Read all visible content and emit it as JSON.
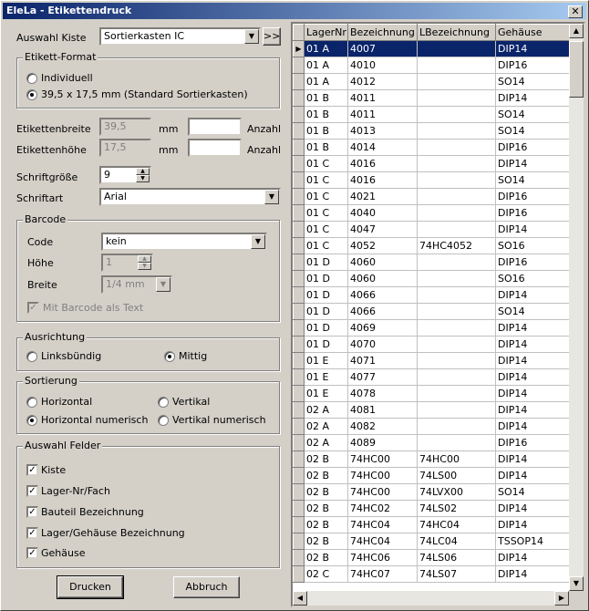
{
  "window": {
    "title": "EleLa - Etikettendruck",
    "close_glyph": "✕"
  },
  "kiste": {
    "label": "Auswahl Kiste",
    "value": "Sortierkasten IC",
    "more_label": ">>"
  },
  "format": {
    "title": "Etikett-Format",
    "options": [
      {
        "label": "Individuell",
        "selected": false
      },
      {
        "label": "39,5 x 17,5 mm (Standard Sortierkasten)",
        "selected": true
      }
    ]
  },
  "size": {
    "width_label": "Etikettenbreite",
    "width_value": "39,5",
    "width_unit": "mm",
    "width_count": "",
    "count_label": "Anzahl",
    "height_label": "Etikettenhöhe",
    "height_value": "17,5",
    "height_unit": "mm",
    "height_count": ""
  },
  "font": {
    "size_label": "Schriftgröße",
    "size_value": "9",
    "type_label": "Schriftart",
    "type_value": "Arial"
  },
  "barcode": {
    "title": "Barcode",
    "code_label": "Code",
    "code_value": "kein",
    "hoehe_label": "Höhe",
    "hoehe_value": "1",
    "breite_label": "Breite",
    "breite_value": "1/4 mm",
    "as_text_label": "Mit Barcode als Text"
  },
  "ausrichtung": {
    "title": "Ausrichtung",
    "left_label": "Linksbündig",
    "center_label": "Mittig"
  },
  "sortierung": {
    "title": "Sortierung",
    "horizontal": "Horizontal",
    "vertikal": "Vertikal",
    "horizontal_num": "Horizontal numerisch",
    "vertikal_num": "Vertikal numerisch"
  },
  "felder": {
    "title": "Auswahl Felder",
    "items": [
      "Kiste",
      "Lager-Nr/Fach",
      "Bauteil Bezeichnung",
      "Lager/Gehäuse Bezeichnung",
      "Gehäuse"
    ]
  },
  "buttons": {
    "print": "Drucken",
    "cancel": "Abbruch"
  },
  "grid": {
    "columns": [
      "LagerNr",
      "Bezeichnung",
      "LBezeichnung",
      "Gehäuse"
    ],
    "rows": [
      [
        "01 A",
        "4007",
        "",
        "DIP14"
      ],
      [
        "01 A",
        "4010",
        "",
        "DIP16"
      ],
      [
        "01 A",
        "4012",
        "",
        "SO14"
      ],
      [
        "01 B",
        "4011",
        "",
        "DIP14"
      ],
      [
        "01 B",
        "4011",
        "",
        "SO14"
      ],
      [
        "01 B",
        "4013",
        "",
        "SO14"
      ],
      [
        "01 B",
        "4014",
        "",
        "DIP16"
      ],
      [
        "01 C",
        "4016",
        "",
        "DIP14"
      ],
      [
        "01 C",
        "4016",
        "",
        "SO14"
      ],
      [
        "01 C",
        "4021",
        "",
        "DIP16"
      ],
      [
        "01 C",
        "4040",
        "",
        "DIP16"
      ],
      [
        "01 C",
        "4047",
        "",
        "DIP14"
      ],
      [
        "01 C",
        "4052",
        "74HC4052",
        "SO16"
      ],
      [
        "01 D",
        "4060",
        "",
        "DIP16"
      ],
      [
        "01 D",
        "4060",
        "",
        "SO16"
      ],
      [
        "01 D",
        "4066",
        "",
        "DIP14"
      ],
      [
        "01 D",
        "4066",
        "",
        "SO14"
      ],
      [
        "01 D",
        "4069",
        "",
        "DIP14"
      ],
      [
        "01 D",
        "4070",
        "",
        "DIP14"
      ],
      [
        "01 E",
        "4071",
        "",
        "DIP14"
      ],
      [
        "01 E",
        "4077",
        "",
        "DIP14"
      ],
      [
        "01 E",
        "4078",
        "",
        "DIP14"
      ],
      [
        "02 A",
        "4081",
        "",
        "DIP14"
      ],
      [
        "02 A",
        "4082",
        "",
        "DIP14"
      ],
      [
        "02 A",
        "4089",
        "",
        "DIP16"
      ],
      [
        "02 B",
        "74HC00",
        "74HC00",
        "DIP14"
      ],
      [
        "02 B",
        "74HC00",
        "74LS00",
        "DIP14"
      ],
      [
        "02 B",
        "74HC00",
        "74LVX00",
        "SO14"
      ],
      [
        "02 B",
        "74HC02",
        "74LS02",
        "DIP14"
      ],
      [
        "02 B",
        "74HC04",
        "74HC04",
        "DIP14"
      ],
      [
        "02 B",
        "74HC04",
        "74LC04",
        "TSSOP14"
      ],
      [
        "02 B",
        "74HC06",
        "74LS06",
        "DIP14"
      ],
      [
        "02 C",
        "74HC07",
        "74LS07",
        "DIP14"
      ]
    ]
  }
}
